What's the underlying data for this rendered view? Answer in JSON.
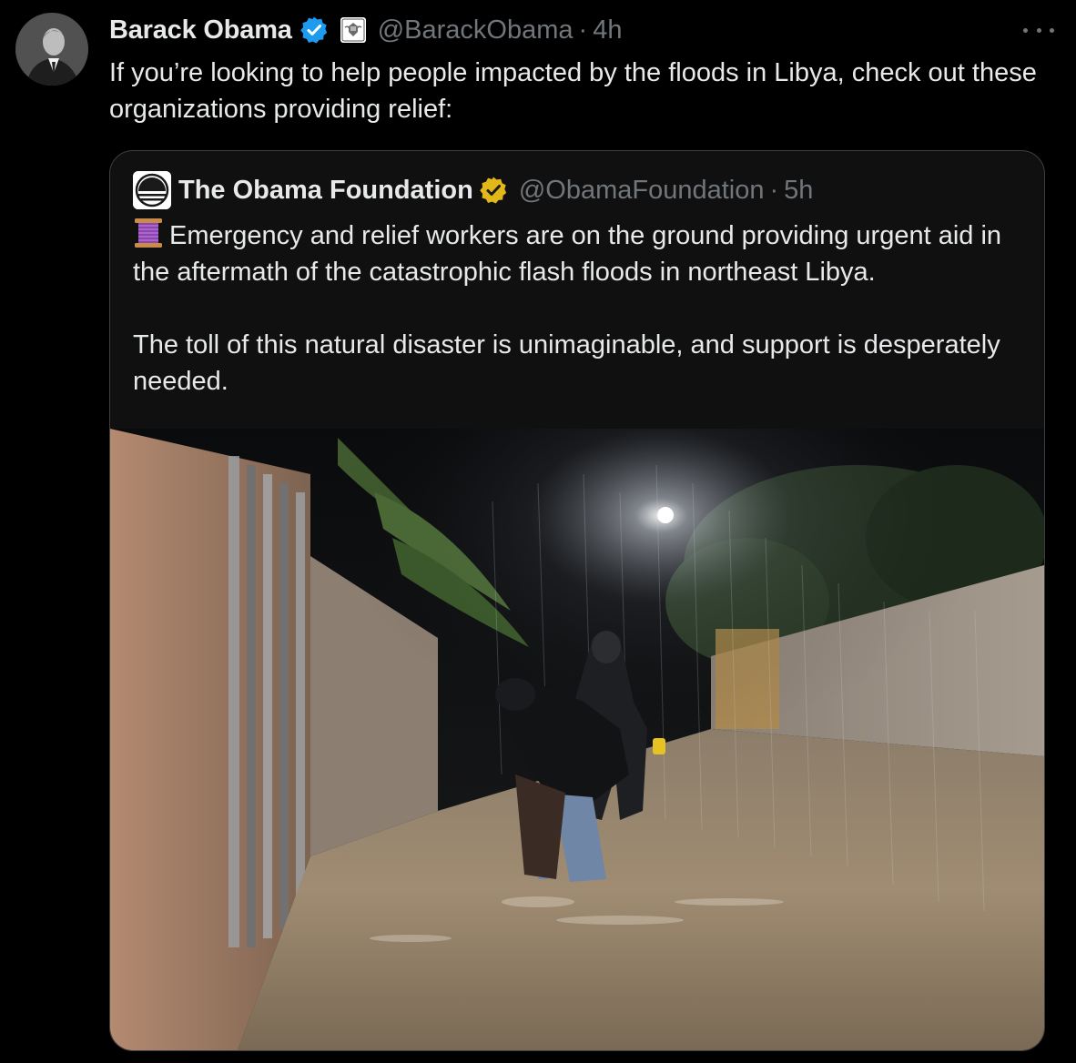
{
  "post": {
    "author_name": "Barack Obama",
    "handle": "@BarackObama",
    "separator": "·",
    "time": "4h",
    "text": "If you’re looking to help people impacted by the floods in Libya, check out these organizations providing relief:",
    "verified_badge_color": "#1d9bf0",
    "badges": [
      "verified-badge-icon",
      "government-seal-icon"
    ],
    "more_menu": "more-options-icon"
  },
  "quoted_post": {
    "author_name": "The Obama Foundation",
    "handle": "@ObamaFoundation",
    "separator": "·",
    "time": "5h",
    "verified_badge_color": "#e2b719",
    "emoji": "spool-of-thread-icon",
    "paragraph1": "Emergency and relief workers are on the ground providing urgent aid in the aftermath of the catastrophic flash floods in northeast Libya.",
    "paragraph2": "The toll of this natural disaster is unimaginable, and support is desperately needed.",
    "image": "photo-of-workers-in-flooded-street-at-night"
  },
  "colors": {
    "background": "#000000",
    "text_primary": "#e7e9ea",
    "text_secondary": "#71767b",
    "card_border": "#3b3f43"
  }
}
